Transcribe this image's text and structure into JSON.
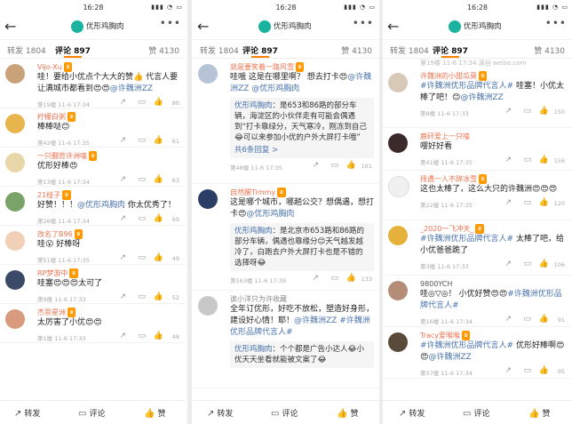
{
  "panels": [
    {
      "time": "16:28",
      "user": "优形鸡胸肉",
      "tabs": {
        "repost": "转发 1804",
        "comment": "评论 897",
        "like": "赞 4130"
      },
      "bottom": {
        "repost": "转发",
        "comment": "评论",
        "like": "赞"
      },
      "comments": [
        {
          "name": "Vijo-Xu",
          "text": "哇！要给小优点个大大的赞👍 代言人要让满城市都看到😍😍@许魏洲ZZ",
          "floor": "第19楼 11-6 17:34",
          "likes": "86"
        },
        {
          "name": "柠檬白粥",
          "text": "棒棒哒😊",
          "floor": "第42楼 11-6 17:35",
          "likes": "61"
        },
        {
          "name": "一只翻背许洲嗑",
          "text": "优形好棒😍",
          "floor": "第13楼 11-6 17:34",
          "likes": "63"
        },
        {
          "name": "21桂子",
          "text": "好赞！！！@优形鸡胸肉 你太优秀了！",
          "floor": "第26楼 11-6 17:34",
          "likes": "69"
        },
        {
          "name": "改名了B96",
          "text": "哇😮 好棒呀",
          "floor": "第51楼 11-6 17:35",
          "likes": "49"
        },
        {
          "name": "RP梦游中",
          "text": "哇塞😍😍😍太可了",
          "floor": "第9楼 11-6 17:33",
          "likes": "52"
        },
        {
          "name": "杰思星洲",
          "text": "太厉害了小优😍😍",
          "floor": "第1楼 11-6 17:33",
          "likes": "48"
        }
      ]
    },
    {
      "time": "16:28",
      "user": "优形鸡胸肉",
      "tabs": {
        "repost": "转发 1804",
        "comment": "评论 897",
        "like": "赞 4130"
      },
      "bottom": {
        "repost": "转发",
        "comment": "评论",
        "like": "赞"
      },
      "comments": [
        {
          "name": "就是要笑着一路风雪",
          "text": "哇哦 这是在哪里啊？ 想去打卡😍@许魏洲ZZ @优形鸡胸肉",
          "quote_name": "优形鸡胸肉",
          "quote": "：是653和86路的部分车辆，海淀区的小伙伴走有可能会偶遇到“打卡靠绿分，天气寒冷，刚冻到自己😂可以来参加小优的户外大屏打卡哦”",
          "quote_more": "共6条回复 >",
          "floor": "第48楼 11-6 17:35",
          "likes": "161"
        },
        {
          "name": "自然醒Timmy",
          "text": "这是哪个城市，哪趟公交？想偶遇，想打卡😍@优形鸡胸肉",
          "quote_name": "优形鸡胸肉",
          "quote": "：是北京市653路和86路的部分车辆，偶遇也靠缘分😊天气越发越冷了，白跑去户外大屏打卡也是不错的选择呀😂",
          "floor": "第163楼 11-6 17:39",
          "likes": "133"
        },
        {
          "name": "诶小洋只为许收藏",
          "text": "全年订优形，好吃不放松，塑造好身形，建设好心情！耶！@许魏洲ZZ #许魏洲优形品牌代言人#",
          "quote_name": "优形鸡胸肉",
          "quote": "：个个都是广告小达人😂小优天天坐看就能被文案了😂",
          "floor": "",
          "likes": ""
        }
      ]
    },
    {
      "time": "16:28",
      "user": "优形鸡胸肉",
      "tabs": {
        "repost": "转发 1804",
        "comment": "评论 897",
        "like": "赞 4130"
      },
      "bottom": {
        "repost": "转发",
        "comment": "评论",
        "like": "赞"
      },
      "truncated": "第19楼 11-6 17:34 源自 weibo.com",
      "comments": [
        {
          "name": "许魏洲的小甜瓜莫",
          "text": "#许魏洲优形品牌代言人# 哇塞！小优太棒了吧！😊@许魏洲ZZ",
          "floor": "第8楼 11-6 17:33",
          "likes": "150"
        },
        {
          "name": "鹿矸爱上一只嗑",
          "text": "嘤好好看",
          "floor": "第41楼 11-6 17:35",
          "likes": "156"
        },
        {
          "name": "择遇一人不辞冰雪",
          "text": "这也太棒了，这么大只的许魏洲😍😍😍",
          "floor": "第22楼 11-6 17:35",
          "likes": "120"
        },
        {
          "name": "_2020一飞冲天_",
          "text": "#许魏洲优形品牌代言人# 太棒了吧，给小优爸爸跪了",
          "floor": "第3楼 11-6 17:33",
          "likes": "106"
        },
        {
          "name": "9800YCH",
          "text": "哇◎▽◎！ 小优好赞😍😍#许魏洲优形品牌代言人#",
          "floor": "第16楼 11-6 17:34",
          "likes": "91"
        },
        {
          "name": "Tracy爱喉喉",
          "text": "#许魏洲优形品牌代言人# 优形好棒啊😍😍@许魏洲ZZ",
          "floor": "第37楼 11-6 17:34",
          "likes": "95"
        }
      ]
    }
  ],
  "icons": {
    "back": "back-arrow-icon",
    "more": "more-dots-icon",
    "share": "share-icon",
    "comment": "comment-icon",
    "like": "like-thumb-icon"
  },
  "colors": {
    "accent": "#ff8200",
    "name": "#eb7350",
    "mention": "#4a73ad",
    "avatar": "#19b3a0"
  }
}
